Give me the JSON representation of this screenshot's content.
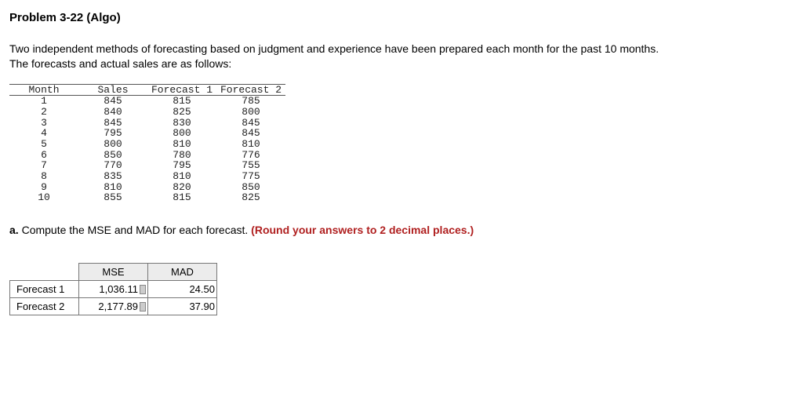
{
  "title": "Problem 3-22 (Algo)",
  "intro_line1": "Two independent methods of forecasting based on judgment and experience have been prepared each month for the past 10 months.",
  "intro_line2": "The forecasts and actual sales are as follows:",
  "table": {
    "headers": {
      "c0": "Month",
      "c1": "Sales",
      "c2": "Forecast 1",
      "c3": "Forecast 2"
    },
    "rows": [
      {
        "c0": "1",
        "c1": "845",
        "c2": "815",
        "c3": "785"
      },
      {
        "c0": "2",
        "c1": "840",
        "c2": "825",
        "c3": "800"
      },
      {
        "c0": "3",
        "c1": "845",
        "c2": "830",
        "c3": "845"
      },
      {
        "c0": "4",
        "c1": "795",
        "c2": "800",
        "c3": "845"
      },
      {
        "c0": "5",
        "c1": "800",
        "c2": "810",
        "c3": "810"
      },
      {
        "c0": "6",
        "c1": "850",
        "c2": "780",
        "c3": "776"
      },
      {
        "c0": "7",
        "c1": "770",
        "c2": "795",
        "c3": "755"
      },
      {
        "c0": "8",
        "c1": "835",
        "c2": "810",
        "c3": "775"
      },
      {
        "c0": "9",
        "c1": "810",
        "c2": "820",
        "c3": "850"
      },
      {
        "c0": "10",
        "c1": "855",
        "c2": "815",
        "c3": "825"
      }
    ]
  },
  "question": {
    "letter": "a.",
    "text": "Compute the MSE and MAD for each forecast.",
    "hint": "(Round your answers to 2 decimal places.)"
  },
  "answers": {
    "col_mse": "MSE",
    "col_mad": "MAD",
    "r1_label": "Forecast 1",
    "r2_label": "Forecast 2",
    "r1_mse": "1,036.11",
    "r1_mad": "24.50",
    "r2_mse": "2,177.89",
    "r2_mad": "37.90"
  }
}
